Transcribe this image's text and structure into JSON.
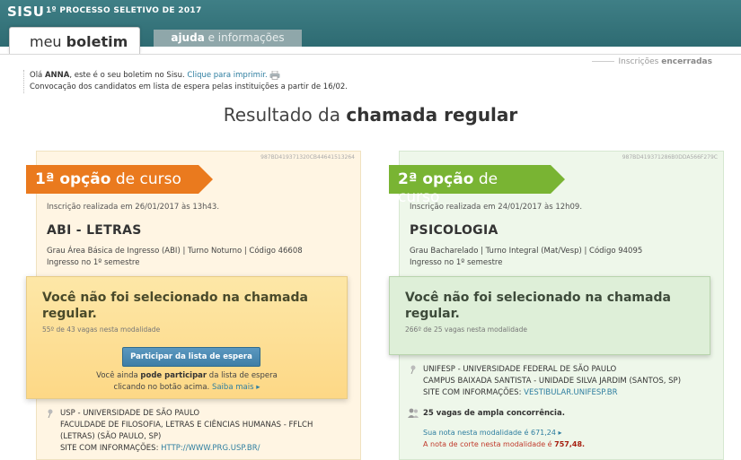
{
  "header": {
    "logo": "SISU",
    "subtitle": "1º PROCESSO SELETIVO DE 2017",
    "tabs": [
      {
        "label_a": "meu ",
        "label_b": "boletim"
      },
      {
        "label_a": "ajuda",
        "label_b": " e informações"
      }
    ],
    "status_label": "Inscrições ",
    "status_value": "encerradas"
  },
  "greeting": {
    "prefix": "Olá ",
    "name": "ANNA",
    "text": ", este é o seu boletim no Sisu. ",
    "print_link": "Clique para imprimir.",
    "line2": "Convocação dos candidatos em lista de espera pelas instituições a partir de 16/02."
  },
  "title": {
    "prefix": "Resultado da ",
    "bold": "chamada regular"
  },
  "cards": [
    {
      "hash": "987BD419371320CB44641513264",
      "ribbon_bold": "1ª opção",
      "ribbon_rest": " de curso",
      "enroll": "Inscrição realizada em 26/01/2017 às 13h43.",
      "course": "ABI - LETRAS",
      "detail1": "Grau Área Básica de Ingresso (ABI) | Turno Noturno | Código 46608",
      "detail2": "Ingresso no 1º semestre",
      "notsel_title": "Você não foi selecionado na chamada regular.",
      "rank": "55º de 43 vagas nesta modalidade",
      "waitlist_button": "Participar da lista de espera",
      "waitlist_a": "Você ainda ",
      "waitlist_b": "pode participar",
      "waitlist_c": " da lista de espera",
      "waitlist_d": "clicando no botão acima. ",
      "learn_more": "Saiba mais ▸",
      "uni_line1": "USP - UNIVERSIDADE DE SÃO PAULO",
      "uni_line2": "FACULDADE DE FILOSOFIA, LETRAS E CIÊNCIAS HUMANAS - FFLCH",
      "uni_line3": "(LETRAS) (SÃO PAULO, SP)",
      "uni_site_label": "SITE COM INFORMAÇÕES: ",
      "uni_site": "HTTP://WWW.PRG.USP.BR/"
    },
    {
      "hash": "987BD419371286B0DDA566F279C",
      "ribbon_bold": "2ª opção",
      "ribbon_rest": " de curso",
      "enroll": "Inscrição realizada em 24/01/2017 às 12h09.",
      "course": "PSICOLOGIA",
      "detail1": "Grau Bacharelado | Turno Integral (Mat/Vesp) | Código 94095",
      "detail2": "Ingresso no 1º semestre",
      "notsel_title": "Você não foi selecionado na chamada regular.",
      "rank": "266º de 25 vagas nesta modalidade",
      "uni_line1": "UNIFESP - UNIVERSIDADE FEDERAL DE SÃO PAULO",
      "uni_line2": "CAMPUS BAIXADA SANTISTA - UNIDADE SILVA JARDIM (SANTOS, SP)",
      "uni_site_label": "SITE COM INFORMAÇÕES: ",
      "uni_site": "VESTIBULAR.UNIFESP.BR",
      "vacancies": "25 vagas de ampla concorrência.",
      "your_score": "Sua nota nesta modalidade é 671,24 ▸",
      "cut_label": "A nota de corte nesta modalidade é ",
      "cut_value": "757,48."
    }
  ]
}
